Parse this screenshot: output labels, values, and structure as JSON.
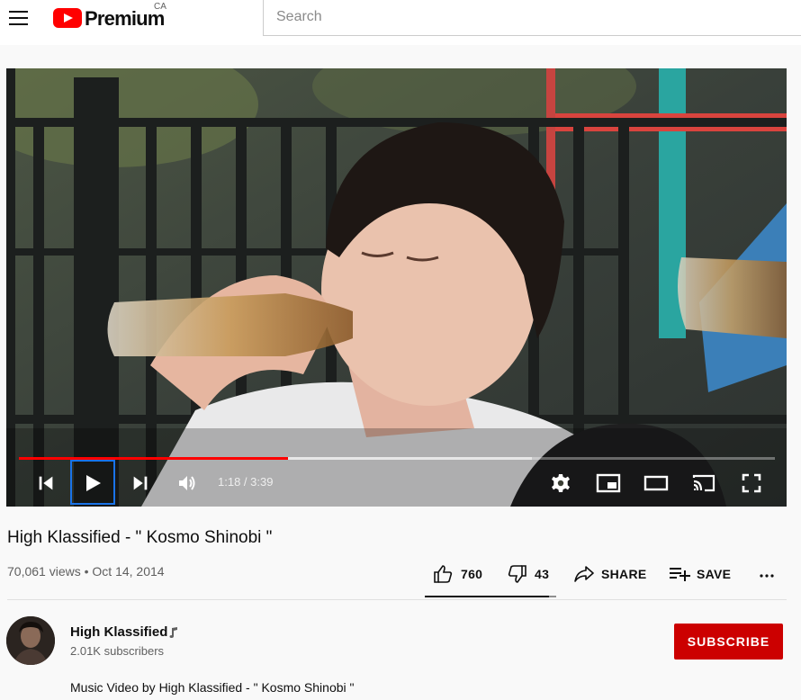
{
  "header": {
    "brand_text": "Premium",
    "country_code": "CA",
    "search_placeholder": "Search"
  },
  "player": {
    "current_time": "1:18",
    "duration": "3:39",
    "time_display": "1:18 / 3:39",
    "played_fraction": 0.356,
    "buffered_fraction": 0.679,
    "controls": [
      "previous-icon",
      "play-icon",
      "next-icon",
      "volume-icon",
      "settings-icon",
      "miniplayer-icon",
      "theater-icon",
      "cast-icon",
      "fullscreen-icon"
    ]
  },
  "video": {
    "title": "High Klassified - \" Kosmo Shinobi \"",
    "views": "70,061 views",
    "separator": "•",
    "date": "Oct 14, 2014",
    "meta_line": "70,061 views • Oct 14, 2014"
  },
  "actions": {
    "likes": "760",
    "dislikes": "43",
    "share_label": "SHARE",
    "save_label": "SAVE",
    "more_label": "..."
  },
  "sentiment": {
    "like_fraction": 0.946
  },
  "channel": {
    "name": "High Klassified",
    "subscribers": "2.01K subscribers",
    "subscribe_label": "SUBSCRIBE",
    "badge_icon": "music-note-icon"
  },
  "description": {
    "text": "Music Video by High Klassified - \" Kosmo Shinobi \""
  },
  "colors": {
    "brand_red": "#ff0000",
    "subscribe_red": "#cc0000",
    "focus_blue": "#1a73e8"
  }
}
